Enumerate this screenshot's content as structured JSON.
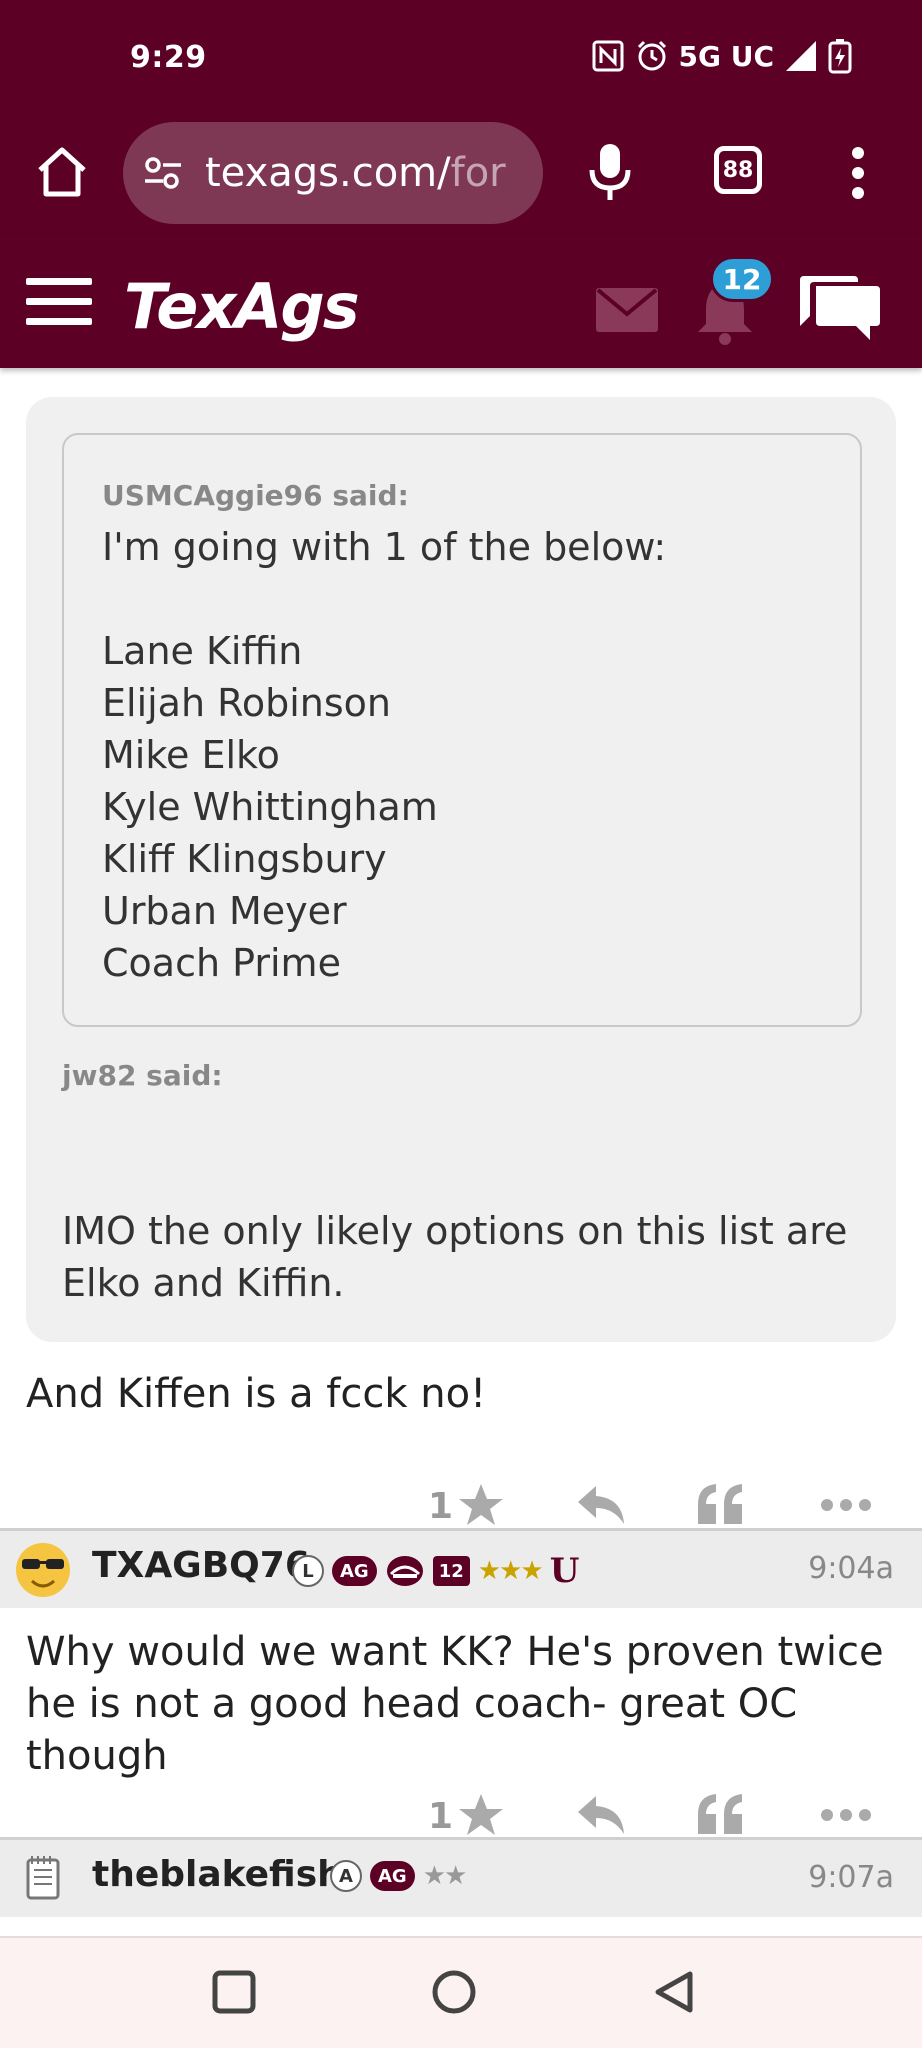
{
  "status_bar": {
    "time": "9:29",
    "network": "5G UC"
  },
  "browser": {
    "url_visible": "texags.com/",
    "url_faded": "for",
    "tab_count": "88"
  },
  "site": {
    "logo": "TexAgs",
    "notification_count": "12",
    "brand_color": "#5c0025",
    "badge_color": "#2e9ed6"
  },
  "quote": {
    "inner_author": "USMCAggie96 said:",
    "inner_text": "I'm going with 1 of the below:\n\nLane Kiffin\nElijah Robinson\nMike Elko\nKyle Whittingham\nKliff Klingsbury\nUrban Meyer\nCoach Prime",
    "outer_author": "jw82 said:",
    "outer_text": "IMO the only likely options on this list are Elko and Kiffin."
  },
  "posts": [
    {
      "text": "And Kiffen is a fcck no!",
      "star_count": "1"
    },
    {
      "username": "TXAGBQ76",
      "badge_letter": "L",
      "badge_ag": "AG",
      "badge_12": "12",
      "stars": "★★★",
      "badge_u": "U",
      "time": "9:04a",
      "text": "Why would we want KK? He's proven twice he is not a good head coach- great OC though",
      "star_count": "1"
    },
    {
      "username": "theblakefish",
      "badge_letter": "A",
      "badge_ag": "AG",
      "stars": "★★",
      "time": "9:07a"
    }
  ]
}
